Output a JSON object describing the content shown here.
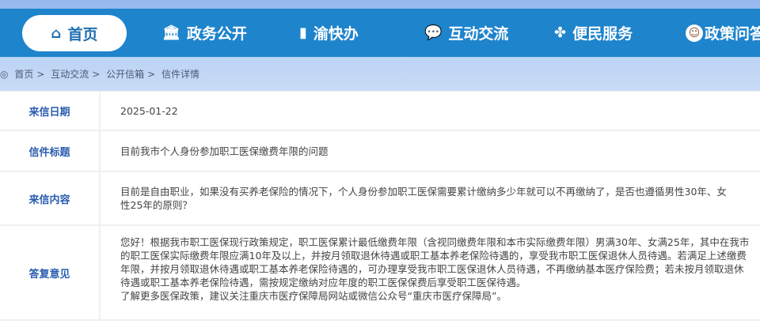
{
  "nav": {
    "items": [
      {
        "label": "首页",
        "icon": "home-icon"
      },
      {
        "label": "政务公开",
        "icon": "building-icon"
      },
      {
        "label": "渝快办",
        "icon": "document-icon"
      },
      {
        "label": "互动交流",
        "icon": "chat-icon"
      },
      {
        "label": "便民服务",
        "icon": "grid-icon"
      },
      {
        "label": "政策问答",
        "icon": "avatar-icon"
      }
    ]
  },
  "breadcrumb": [
    "首页",
    "互动交流",
    "公开信箱",
    "信件详情"
  ],
  "breadcrumb_sep": ">",
  "letter": {
    "date_label": "来信日期",
    "date": "2025-01-22",
    "title_label": "信件标题",
    "title": "目前我市个人身份参加职工医保缴费年限的问题",
    "content_label": "来信内容",
    "content": "目前是自由职业，如果没有买养老保险的情况下，个人身份参加职工医保需要累计缴纳多少年就可以不再缴纳了，是否也遵循男性30年、女性25年的原则？",
    "reply_label": "答复意见",
    "reply": [
      "您好！根据我市职工医保现行政策规定，职工医保累计最低缴费年限（含视同缴费年限和本市实际缴费年限）男满30年、女满25年，其中在我市的职工医保实际缴费年限应满10年及以上，并按月领取退休待遇或职工基本养老保险待遇的，享受我市职工医保退休人员待遇。若满足上述缴费年限，并按月领取退休待遇或职工基本养老保险待遇的，可办理享受我市职工医保退休人员待遇，不再缴纳基本医疗保险费；若未按月领取退休待遇或职工基本养老保险待遇，需按规定缴纳对应年度的职工医保保费后享受职工医保待遇。",
      "了解更多医保政策，建议关注重庆市医疗保障局网站或微信公众号“重庆市医疗保障局”。"
    ]
  }
}
